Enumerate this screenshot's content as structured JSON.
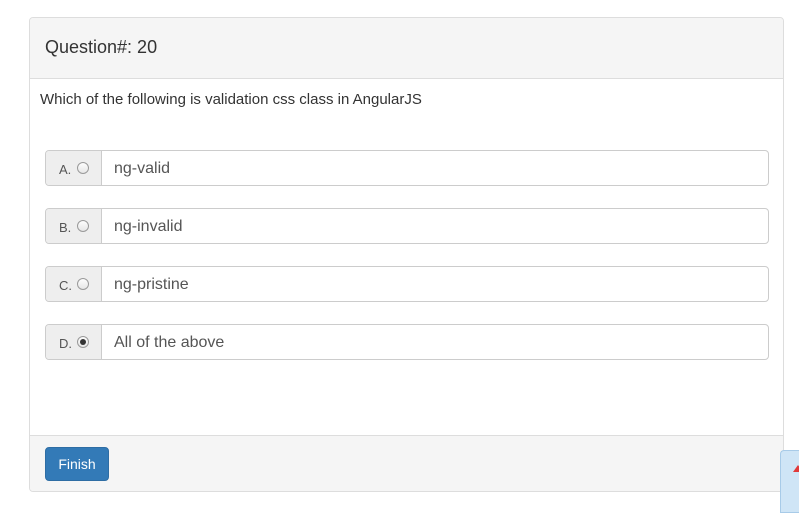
{
  "question": {
    "heading": "Question#: 20",
    "text": "Which of the following is validation css class in AngularJS"
  },
  "options": [
    {
      "letter": "A.",
      "text": "ng-valid",
      "checked": false
    },
    {
      "letter": "B.",
      "text": "ng-invalid",
      "checked": false
    },
    {
      "letter": "C.",
      "text": "ng-pristine",
      "checked": false
    },
    {
      "letter": "D.",
      "text": "All of the above",
      "checked": true
    }
  ],
  "footer": {
    "finish_label": "Finish"
  },
  "colors": {
    "primary_button": "#337ab7",
    "panel_bg": "#f5f5f5",
    "addon_bg": "#eeeeee"
  },
  "icons": {
    "scroll_top": "arrow-up-icon"
  }
}
